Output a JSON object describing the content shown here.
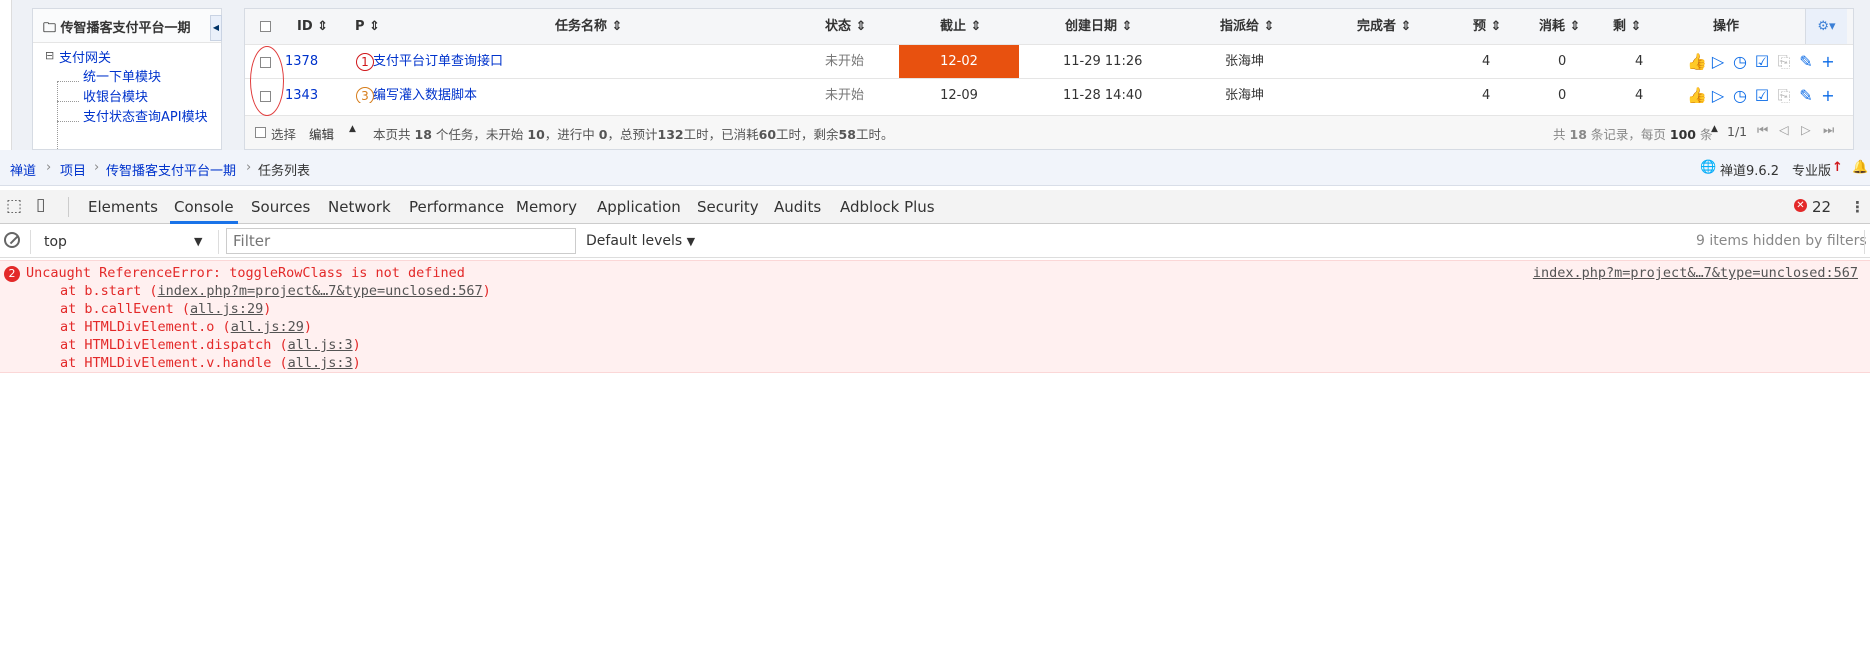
{
  "tree": {
    "title": "传智播客支付平台一期",
    "root": "支付网关",
    "children": [
      "统一下单模块",
      "收银台模块",
      "支付状态查询API模块"
    ]
  },
  "grid": {
    "columns": [
      "ID",
      "P",
      "任务名称",
      "状态",
      "截止",
      "创建日期",
      "指派给",
      "完成者",
      "预",
      "消耗",
      "剩",
      "操作"
    ],
    "rows": [
      {
        "id": "1378",
        "p": "1",
        "name": "支付平台订单查询接口",
        "status": "未开始",
        "deadline": "12-02",
        "created": "11-29 11:26",
        "assigned": "张海坤",
        "finisher": "",
        "estimate": "4",
        "consumed": "0",
        "left": "4"
      },
      {
        "id": "1343",
        "p": "3",
        "name": "编写灌入数据脚本",
        "status": "未开始",
        "deadline": "12-09",
        "created": "11-28 14:40",
        "assigned": "张海坤",
        "finisher": "",
        "estimate": "4",
        "consumed": "0",
        "left": "4"
      }
    ],
    "footer": {
      "select_label": "选择",
      "edit_label": "编辑",
      "summary_prefix": "本页共",
      "summary_count": "18",
      "summary_mid1": "个任务，未开始",
      "not_started": "10",
      "summary_mid2": "，进行中",
      "in_progress": "0",
      "summary_mid3": "，总预计",
      "total_estimate": "132",
      "summary_mid4": "工时，已消耗",
      "consumed_total": "60",
      "summary_mid5": "工时，剩余",
      "left_total": "58",
      "summary_suffix": "工时。",
      "records_prefix": "共",
      "records_count": "18",
      "records_mid": "条记录，每页",
      "per_page": "100",
      "records_suffix": "条",
      "page_info": "1/1"
    }
  },
  "breadcrumb": {
    "items": [
      "禅道",
      "项目",
      "传智播客支付平台一期",
      "任务列表"
    ],
    "version": "禅道9.6.2",
    "edition": "专业版"
  },
  "devtools": {
    "tabs": [
      "Elements",
      "Console",
      "Sources",
      "Network",
      "Performance",
      "Memory",
      "Application",
      "Security",
      "Audits",
      "Adblock Plus"
    ],
    "active_tab": "Console",
    "error_count": "22",
    "context": "top",
    "filter_placeholder": "Filter",
    "levels": "Default levels",
    "hidden_info": "9 items hidden by filters"
  },
  "console": {
    "repeat_count": "2",
    "error_message": "Uncaught ReferenceError: toggleRowClass is not defined",
    "source": "index.php?m=project&…7&type=unclosed:567",
    "stack": [
      {
        "prefix": "at b.start (",
        "link": "index.php?m=project&…7&type=unclosed:567",
        "suffix": ")"
      },
      {
        "prefix": "at b.callEvent (",
        "link": "all.js:29",
        "suffix": ")"
      },
      {
        "prefix": "at HTMLDivElement.o (",
        "link": "all.js:29",
        "suffix": ")"
      },
      {
        "prefix": "at HTMLDivElement.dispatch (",
        "link": "all.js:3",
        "suffix": ")"
      },
      {
        "prefix": "at HTMLDivElement.v.handle (",
        "link": "all.js:3",
        "suffix": ")"
      }
    ]
  },
  "colors": {
    "deadline_overdue": "#e8510f",
    "error_red": "#e32929",
    "link_blue": "#0033cc",
    "tab_active": "#1a73e8"
  }
}
